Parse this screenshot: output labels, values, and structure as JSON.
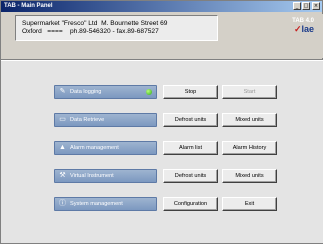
{
  "window": {
    "title": "TAB - Main Panel",
    "controls": [
      "_",
      "□",
      "×"
    ]
  },
  "info": {
    "line1": "Supermarket \"Fresco\" Ltd  M. Bournette Street 69",
    "line2": "Oxford   ====    ph.89-546320 - fax.89-687527"
  },
  "brand": {
    "version": "TAB 4.0",
    "logo_mark": "✓",
    "logo_text": "lae"
  },
  "rows": [
    {
      "label": "Data logging",
      "icon": "pencil-icon",
      "status_led": "#2eaa1a",
      "buttons": [
        {
          "label": "Stop",
          "enabled": true
        },
        {
          "label": "Start",
          "enabled": false
        }
      ]
    },
    {
      "label": "Data Retrieve",
      "icon": "display-icon",
      "buttons": [
        {
          "label": "Defrost units",
          "enabled": true
        },
        {
          "label": "Mixed units",
          "enabled": true
        }
      ]
    },
    {
      "label": "Alarm management",
      "icon": "bell-icon",
      "buttons": [
        {
          "label": "Alarm list",
          "enabled": true
        },
        {
          "label": "Alarm History",
          "enabled": true
        }
      ]
    },
    {
      "label": "Virtual  Instrument",
      "icon": "wrench-icon",
      "buttons": [
        {
          "label": "Defrost units",
          "enabled": true
        },
        {
          "label": "Mixed units",
          "enabled": true
        }
      ]
    },
    {
      "label": "System management",
      "icon": "info-icon",
      "buttons": [
        {
          "label": "Configuration",
          "enabled": true
        },
        {
          "label": "Exit",
          "enabled": true
        }
      ]
    }
  ]
}
